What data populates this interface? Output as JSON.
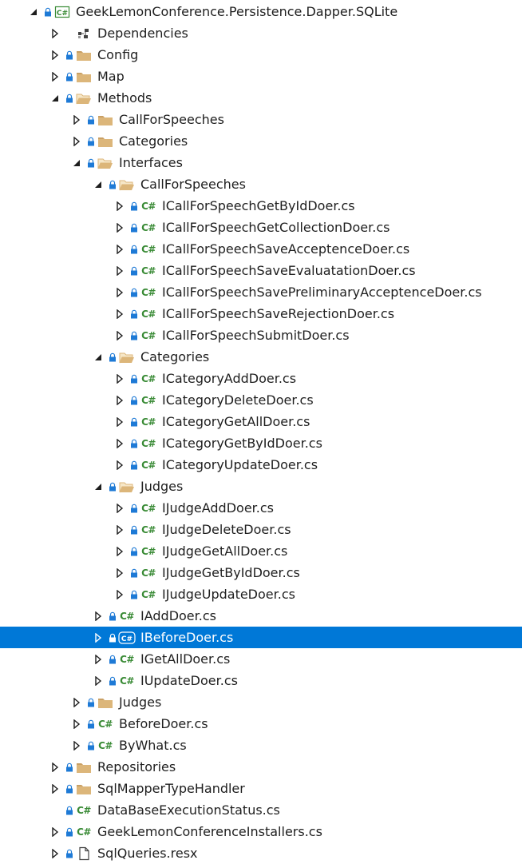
{
  "colors": {
    "selection": "#0078d7",
    "csharp": "#388a34",
    "folder": "#dcb67a",
    "lock": "#1e7ad6"
  },
  "tree": [
    {
      "label": "GeekLemonConference.Persistence.Dapper.SQLite",
      "depth": 0,
      "expander": "expanded",
      "lock": true,
      "icon": "csharp-project-icon"
    },
    {
      "label": "Dependencies",
      "depth": 1,
      "expander": "collapsed",
      "lock": false,
      "icon": "dependencies-icon"
    },
    {
      "label": "Config",
      "depth": 1,
      "expander": "collapsed",
      "lock": true,
      "icon": "folder-icon"
    },
    {
      "label": "Map",
      "depth": 1,
      "expander": "collapsed",
      "lock": true,
      "icon": "folder-icon"
    },
    {
      "label": "Methods",
      "depth": 1,
      "expander": "expanded",
      "lock": true,
      "icon": "folder-open-icon"
    },
    {
      "label": "CallForSpeeches",
      "depth": 2,
      "expander": "collapsed",
      "lock": true,
      "icon": "folder-icon"
    },
    {
      "label": "Categories",
      "depth": 2,
      "expander": "collapsed",
      "lock": true,
      "icon": "folder-icon"
    },
    {
      "label": "Interfaces",
      "depth": 2,
      "expander": "expanded",
      "lock": true,
      "icon": "folder-open-icon"
    },
    {
      "label": "CallForSpeeches",
      "depth": 3,
      "expander": "expanded",
      "lock": true,
      "icon": "folder-open-icon"
    },
    {
      "label": "ICallForSpeechGetByIdDoer.cs",
      "depth": 4,
      "expander": "collapsed",
      "lock": true,
      "icon": "csharp-file-icon"
    },
    {
      "label": "ICallForSpeechGetCollectionDoer.cs",
      "depth": 4,
      "expander": "collapsed",
      "lock": true,
      "icon": "csharp-file-icon"
    },
    {
      "label": "ICallForSpeechSaveAcceptenceDoer.cs",
      "depth": 4,
      "expander": "collapsed",
      "lock": true,
      "icon": "csharp-file-icon"
    },
    {
      "label": "ICallForSpeechSaveEvaluatationDoer.cs",
      "depth": 4,
      "expander": "collapsed",
      "lock": true,
      "icon": "csharp-file-icon"
    },
    {
      "label": "ICallForSpeechSavePreliminaryAcceptenceDoer.cs",
      "depth": 4,
      "expander": "collapsed",
      "lock": true,
      "icon": "csharp-file-icon"
    },
    {
      "label": "ICallForSpeechSaveRejectionDoer.cs",
      "depth": 4,
      "expander": "collapsed",
      "lock": true,
      "icon": "csharp-file-icon"
    },
    {
      "label": "ICallForSpeechSubmitDoer.cs",
      "depth": 4,
      "expander": "collapsed",
      "lock": true,
      "icon": "csharp-file-icon"
    },
    {
      "label": "Categories",
      "depth": 3,
      "expander": "expanded",
      "lock": true,
      "icon": "folder-open-icon"
    },
    {
      "label": "ICategoryAddDoer.cs",
      "depth": 4,
      "expander": "collapsed",
      "lock": true,
      "icon": "csharp-file-icon"
    },
    {
      "label": "ICategoryDeleteDoer.cs",
      "depth": 4,
      "expander": "collapsed",
      "lock": true,
      "icon": "csharp-file-icon"
    },
    {
      "label": "ICategoryGetAllDoer.cs",
      "depth": 4,
      "expander": "collapsed",
      "lock": true,
      "icon": "csharp-file-icon"
    },
    {
      "label": "ICategoryGetByIdDoer.cs",
      "depth": 4,
      "expander": "collapsed",
      "lock": true,
      "icon": "csharp-file-icon"
    },
    {
      "label": "ICategoryUpdateDoer.cs",
      "depth": 4,
      "expander": "collapsed",
      "lock": true,
      "icon": "csharp-file-icon"
    },
    {
      "label": "Judges",
      "depth": 3,
      "expander": "expanded",
      "lock": true,
      "icon": "folder-open-icon"
    },
    {
      "label": "IJudgeAddDoer.cs",
      "depth": 4,
      "expander": "collapsed",
      "lock": true,
      "icon": "csharp-file-icon"
    },
    {
      "label": "IJudgeDeleteDoer.cs",
      "depth": 4,
      "expander": "collapsed",
      "lock": true,
      "icon": "csharp-file-icon"
    },
    {
      "label": "IJudgeGetAllDoer.cs",
      "depth": 4,
      "expander": "collapsed",
      "lock": true,
      "icon": "csharp-file-icon"
    },
    {
      "label": "IJudgeGetByIdDoer.cs",
      "depth": 4,
      "expander": "collapsed",
      "lock": true,
      "icon": "csharp-file-icon"
    },
    {
      "label": "IJudgeUpdateDoer.cs",
      "depth": 4,
      "expander": "collapsed",
      "lock": true,
      "icon": "csharp-file-icon"
    },
    {
      "label": "IAddDoer.cs",
      "depth": 3,
      "expander": "collapsed",
      "lock": true,
      "icon": "csharp-file-icon"
    },
    {
      "label": "IBeforeDoer.cs",
      "depth": 3,
      "expander": "collapsed",
      "lock": true,
      "icon": "csharp-file-icon",
      "selected": true
    },
    {
      "label": "IGetAllDoer.cs",
      "depth": 3,
      "expander": "collapsed",
      "lock": true,
      "icon": "csharp-file-icon"
    },
    {
      "label": "IUpdateDoer.cs",
      "depth": 3,
      "expander": "collapsed",
      "lock": true,
      "icon": "csharp-file-icon"
    },
    {
      "label": "Judges",
      "depth": 2,
      "expander": "collapsed",
      "lock": true,
      "icon": "folder-icon"
    },
    {
      "label": "BeforeDoer.cs",
      "depth": 2,
      "expander": "collapsed",
      "lock": true,
      "icon": "csharp-file-icon"
    },
    {
      "label": "ByWhat.cs",
      "depth": 2,
      "expander": "collapsed",
      "lock": true,
      "icon": "csharp-file-icon"
    },
    {
      "label": "Repositories",
      "depth": 1,
      "expander": "collapsed",
      "lock": true,
      "icon": "folder-icon"
    },
    {
      "label": "SqlMapperTypeHandler",
      "depth": 1,
      "expander": "collapsed",
      "lock": true,
      "icon": "folder-icon"
    },
    {
      "label": "DataBaseExecutionStatus.cs",
      "depth": 1,
      "expander": "none",
      "lock": true,
      "icon": "csharp-file-icon"
    },
    {
      "label": "GeekLemonConferenceInstallers.cs",
      "depth": 1,
      "expander": "collapsed",
      "lock": true,
      "icon": "csharp-file-icon"
    },
    {
      "label": "SqlQueries.resx",
      "depth": 1,
      "expander": "collapsed",
      "lock": true,
      "icon": "resx-file-icon"
    }
  ]
}
